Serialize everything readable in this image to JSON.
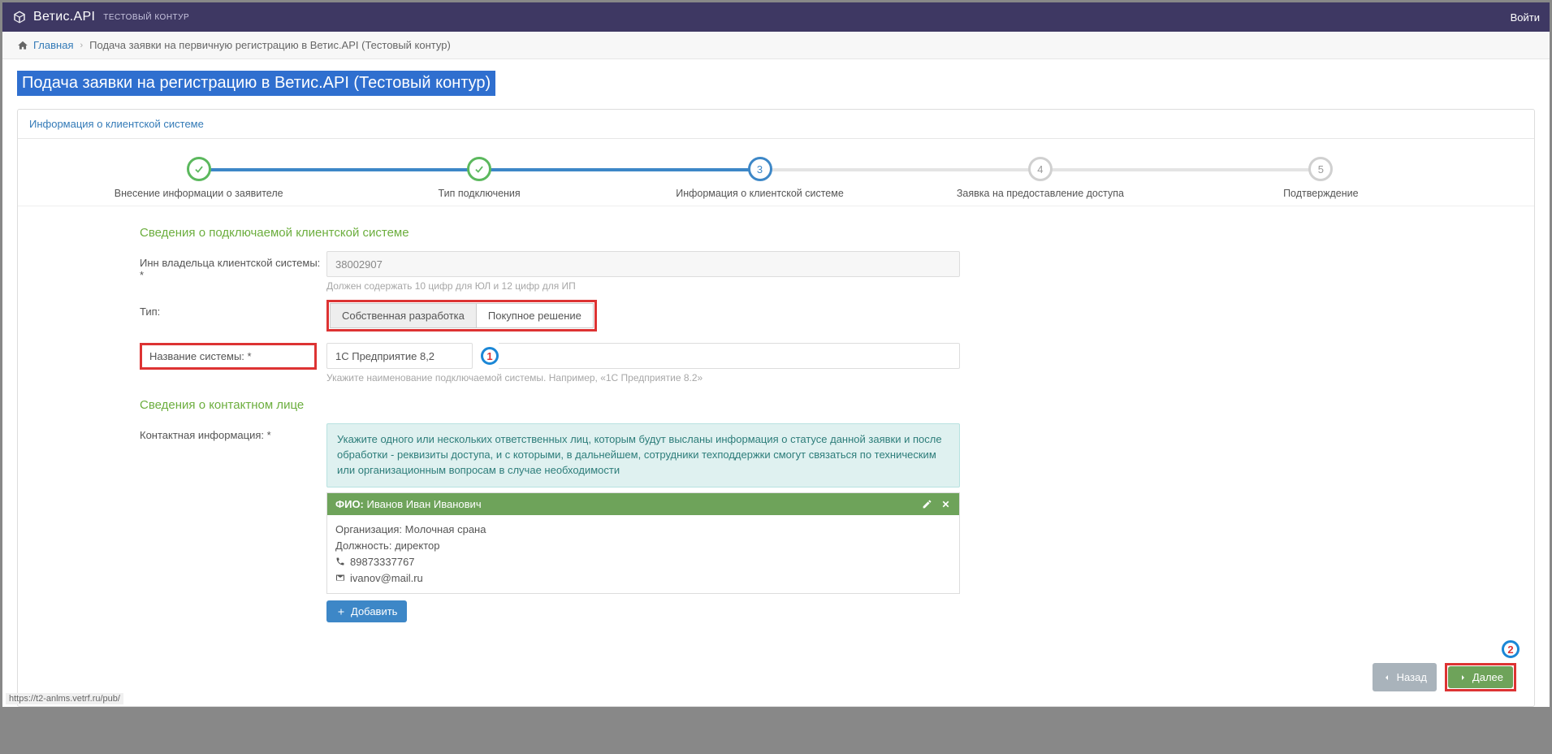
{
  "header": {
    "brand": "Ветис.API",
    "env": "ТЕСТОВЫЙ КОНТУР",
    "login": "Войти"
  },
  "breadcrumbs": {
    "home": "Главная",
    "current": "Подача заявки на первичную регистрацию в Ветис.API (Тестовый контур)"
  },
  "page_title": "Подача заявки на регистрацию в Ветис.API (Тестовый контур)",
  "panel_header": "Информация о клиентской системе",
  "steps": {
    "s1": "Внесение информации о заявителе",
    "s2": "Тип подключения",
    "s3": "Информация о клиентской системе",
    "s4": "Заявка на предоставление доступа",
    "s5": "Подтверждение",
    "n3": "3",
    "n4": "4",
    "n5": "5"
  },
  "section1_title": "Сведения о подключаемой клиентской системе",
  "inn": {
    "label": "Инн владельца клиентской системы: *",
    "value": "38002907",
    "hint": "Должен содержать 10 цифр для ЮЛ и 12 цифр для ИП"
  },
  "type": {
    "label": "Тип:",
    "opt1": "Собственная разработка",
    "opt2": "Покупное решение"
  },
  "sysname": {
    "label": "Название системы: *",
    "value": "1С Предприятие 8,2",
    "hint": "Укажите наименование подключаемой системы. Например, «1С Предприятие 8.2»"
  },
  "section2_title": "Сведения о контактном лице",
  "contact_label": "Контактная информация: *",
  "contact_info_box": "Укажите одного или нескольких ответственных лиц, которым будут высланы информация о статусе данной заявки и после обработки - реквизиты доступа, и с которыми, в дальнейшем, сотрудники техподдержки смогут связаться по техническим или организационным вопросам в случае необходимости",
  "contact": {
    "fio_label": "ФИО:",
    "fio": "Иванов Иван Иванович",
    "org_label": "Организация:",
    "org": "Молочная срана",
    "pos_label": "Должность:",
    "pos": "директор",
    "phone": "89873337767",
    "email": "ivanov@mail.ru"
  },
  "buttons": {
    "add": "Добавить",
    "back": "Назад",
    "next": "Далее"
  },
  "callouts": {
    "c1": "1",
    "c2": "2"
  },
  "status_url": "https://t2-anlms.vetrf.ru/pub/"
}
